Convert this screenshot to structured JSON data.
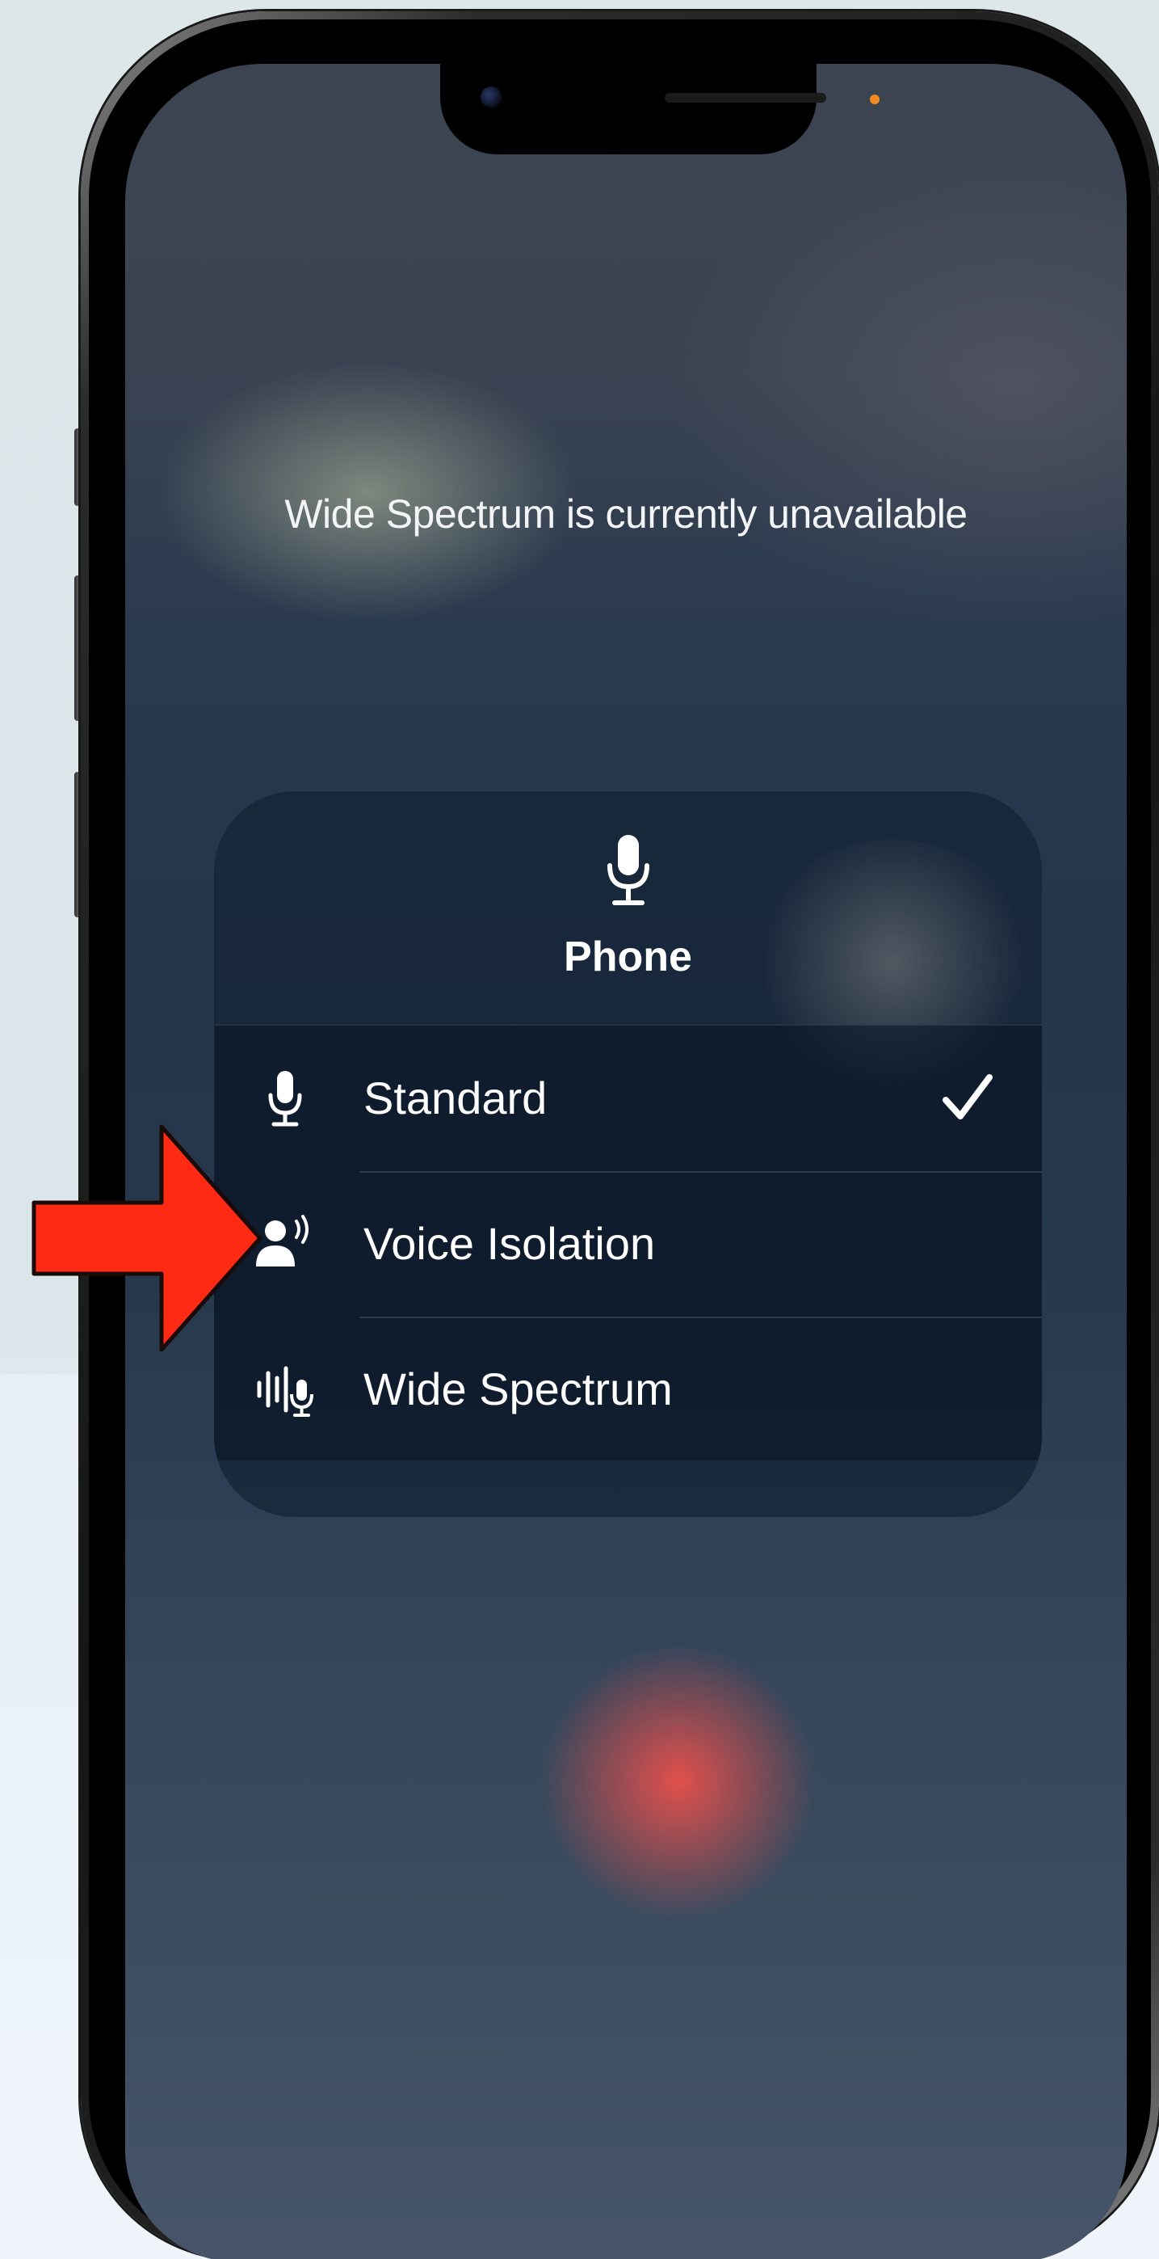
{
  "status_message": "Wide Spectrum is currently unavailable",
  "mic_mode_menu": {
    "header_icon": "microphone-icon",
    "title": "Phone",
    "options": [
      {
        "label": "Standard",
        "icon": "microphone-icon",
        "selected": true
      },
      {
        "label": "Voice Isolation",
        "icon": "voice-isolation-icon",
        "selected": false
      },
      {
        "label": "Wide Spectrum",
        "icon": "wide-spectrum-icon",
        "selected": false
      }
    ],
    "selected_indicator_icon": "checkmark-icon"
  },
  "annotation": {
    "icon": "red-arrow-icon",
    "color": "#ff2a14",
    "points_to": "Voice Isolation"
  },
  "colors": {
    "accent_orange_dot": "#f08a20",
    "text": "#ffffff",
    "screen_background": "#24354c"
  }
}
